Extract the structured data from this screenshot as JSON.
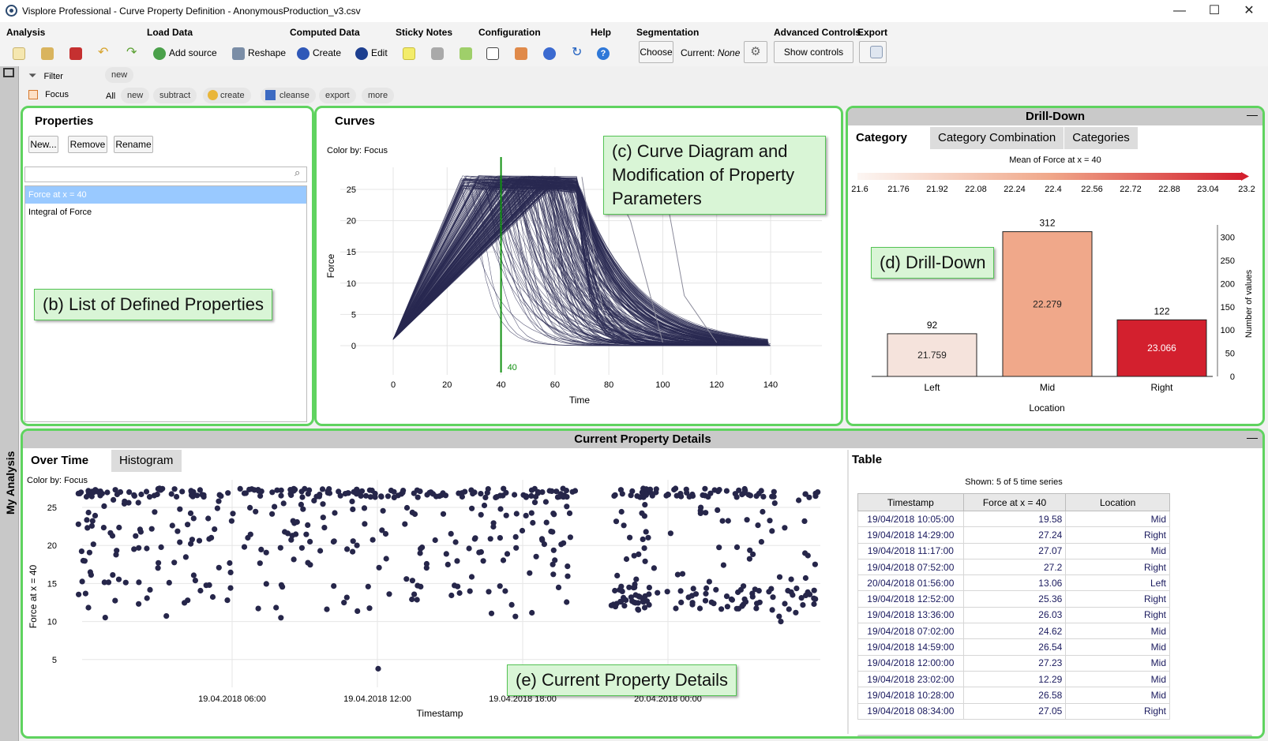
{
  "window": {
    "title": "Visplore Professional - Curve Property Definition - AnonymousProduction_v3.csv",
    "minimize": "—",
    "maximize": "☐",
    "close": "✕"
  },
  "ribbon": {
    "groups": {
      "analysis": "Analysis",
      "load_data": "Load Data",
      "computed_data": "Computed Data",
      "sticky_notes": "Sticky Notes",
      "configuration": "Configuration",
      "help": "Help",
      "segmentation": "Segmentation",
      "advanced_controls": "Advanced Controls",
      "export": "Export"
    },
    "add_source": "Add source",
    "reshape": "Reshape",
    "create": "Create",
    "edit": "Edit",
    "choose": "Choose",
    "current_label": "Current:",
    "current_value": "None",
    "show_controls": "Show controls"
  },
  "filterbar": {
    "filter_label": "Filter",
    "filter_new": "new",
    "focus_label": "Focus",
    "all": "All",
    "chips": [
      "new",
      "subtract",
      "create",
      "cleanse",
      "export",
      "more"
    ]
  },
  "sidebar": {
    "label": "My Analysis"
  },
  "properties": {
    "title": "Properties",
    "new_button": "New...",
    "remove_button": "Remove",
    "rename_button": "Rename",
    "search_placeholder": "",
    "items": [
      "Force at x = 40",
      "Integral of Force"
    ],
    "callout": "(b) List of Defined Properties"
  },
  "curves": {
    "title": "Curves",
    "color_by": "Color by: Focus",
    "callout": "(c) Curve Diagram and Modification of Property Parameters",
    "marker_label": "40"
  },
  "drilldown": {
    "header": "Drill-Down",
    "tabs": [
      "Category",
      "Category Combination",
      "Categories"
    ],
    "legend_title": "Mean of Force at x = 40",
    "legend_ticks": [
      "21.6",
      "21.76",
      "21.92",
      "22.08",
      "22.24",
      "22.4",
      "22.56",
      "22.72",
      "22.88",
      "23.04",
      "23.2"
    ],
    "callout": "(d) Drill-Down"
  },
  "details": {
    "header": "Current Property Details",
    "tabs": [
      "Over Time",
      "Histogram"
    ],
    "color_by": "Color by: Focus",
    "callout": "(e) Current Property Details"
  },
  "table": {
    "title": "Table",
    "shown": "Shown: 5 of 5 time series",
    "columns": [
      "Timestamp",
      "Force at x = 40",
      "Location"
    ],
    "rows": [
      [
        "19/04/2018 10:05:00",
        "19.58",
        "Mid"
      ],
      [
        "19/04/2018 14:29:00",
        "27.24",
        "Right"
      ],
      [
        "19/04/2018 11:17:00",
        "27.07",
        "Mid"
      ],
      [
        "19/04/2018 07:52:00",
        "27.2",
        "Right"
      ],
      [
        "20/04/2018 01:56:00",
        "13.06",
        "Left"
      ],
      [
        "19/04/2018 12:52:00",
        "25.36",
        "Right"
      ],
      [
        "19/04/2018 13:36:00",
        "26.03",
        "Right"
      ],
      [
        "19/04/2018 07:02:00",
        "24.62",
        "Mid"
      ],
      [
        "19/04/2018 14:59:00",
        "26.54",
        "Mid"
      ],
      [
        "19/04/2018 12:00:00",
        "27.23",
        "Mid"
      ],
      [
        "19/04/2018 23:02:00",
        "12.29",
        "Mid"
      ],
      [
        "19/04/2018 10:28:00",
        "26.58",
        "Mid"
      ],
      [
        "19/04/2018 08:34:00",
        "27.05",
        "Right"
      ]
    ]
  },
  "chart_data": [
    {
      "type": "line",
      "xlabel": "Time",
      "ylabel": "Force",
      "xlim": [
        0,
        140
      ],
      "ylim": [
        -3,
        27
      ],
      "xticks": [
        0,
        20,
        40,
        60,
        80,
        100,
        120,
        140
      ],
      "yticks": [
        0,
        5,
        10,
        15,
        20,
        25
      ],
      "marker_x": 40,
      "series_color": "#2a2a52",
      "grid": true
    },
    {
      "type": "bar",
      "categories": [
        "Left",
        "Mid",
        "Right"
      ],
      "values": [
        92,
        312,
        122
      ],
      "means": [
        "21.759",
        "22.279",
        "23.066"
      ],
      "colors": [
        "#f5e3dc",
        "#f0a88a",
        "#d3202e"
      ],
      "xlabel": "Location",
      "ylabel": "Number of values",
      "ylim": [
        0,
        330
      ],
      "yticks": [
        0,
        50,
        100,
        150,
        200,
        250,
        300
      ]
    },
    {
      "type": "scatter",
      "xlabel": "Timestamp",
      "ylabel": "Force at x = 40",
      "xticks": [
        "19.04.2018 06:00",
        "19.04.2018 12:00",
        "19.04.2018 18:00",
        "20.04.2018 00:00"
      ],
      "yticks": [
        5,
        10,
        15,
        20,
        25
      ],
      "ylim": [
        2,
        28
      ],
      "color": "#26264a"
    }
  ]
}
